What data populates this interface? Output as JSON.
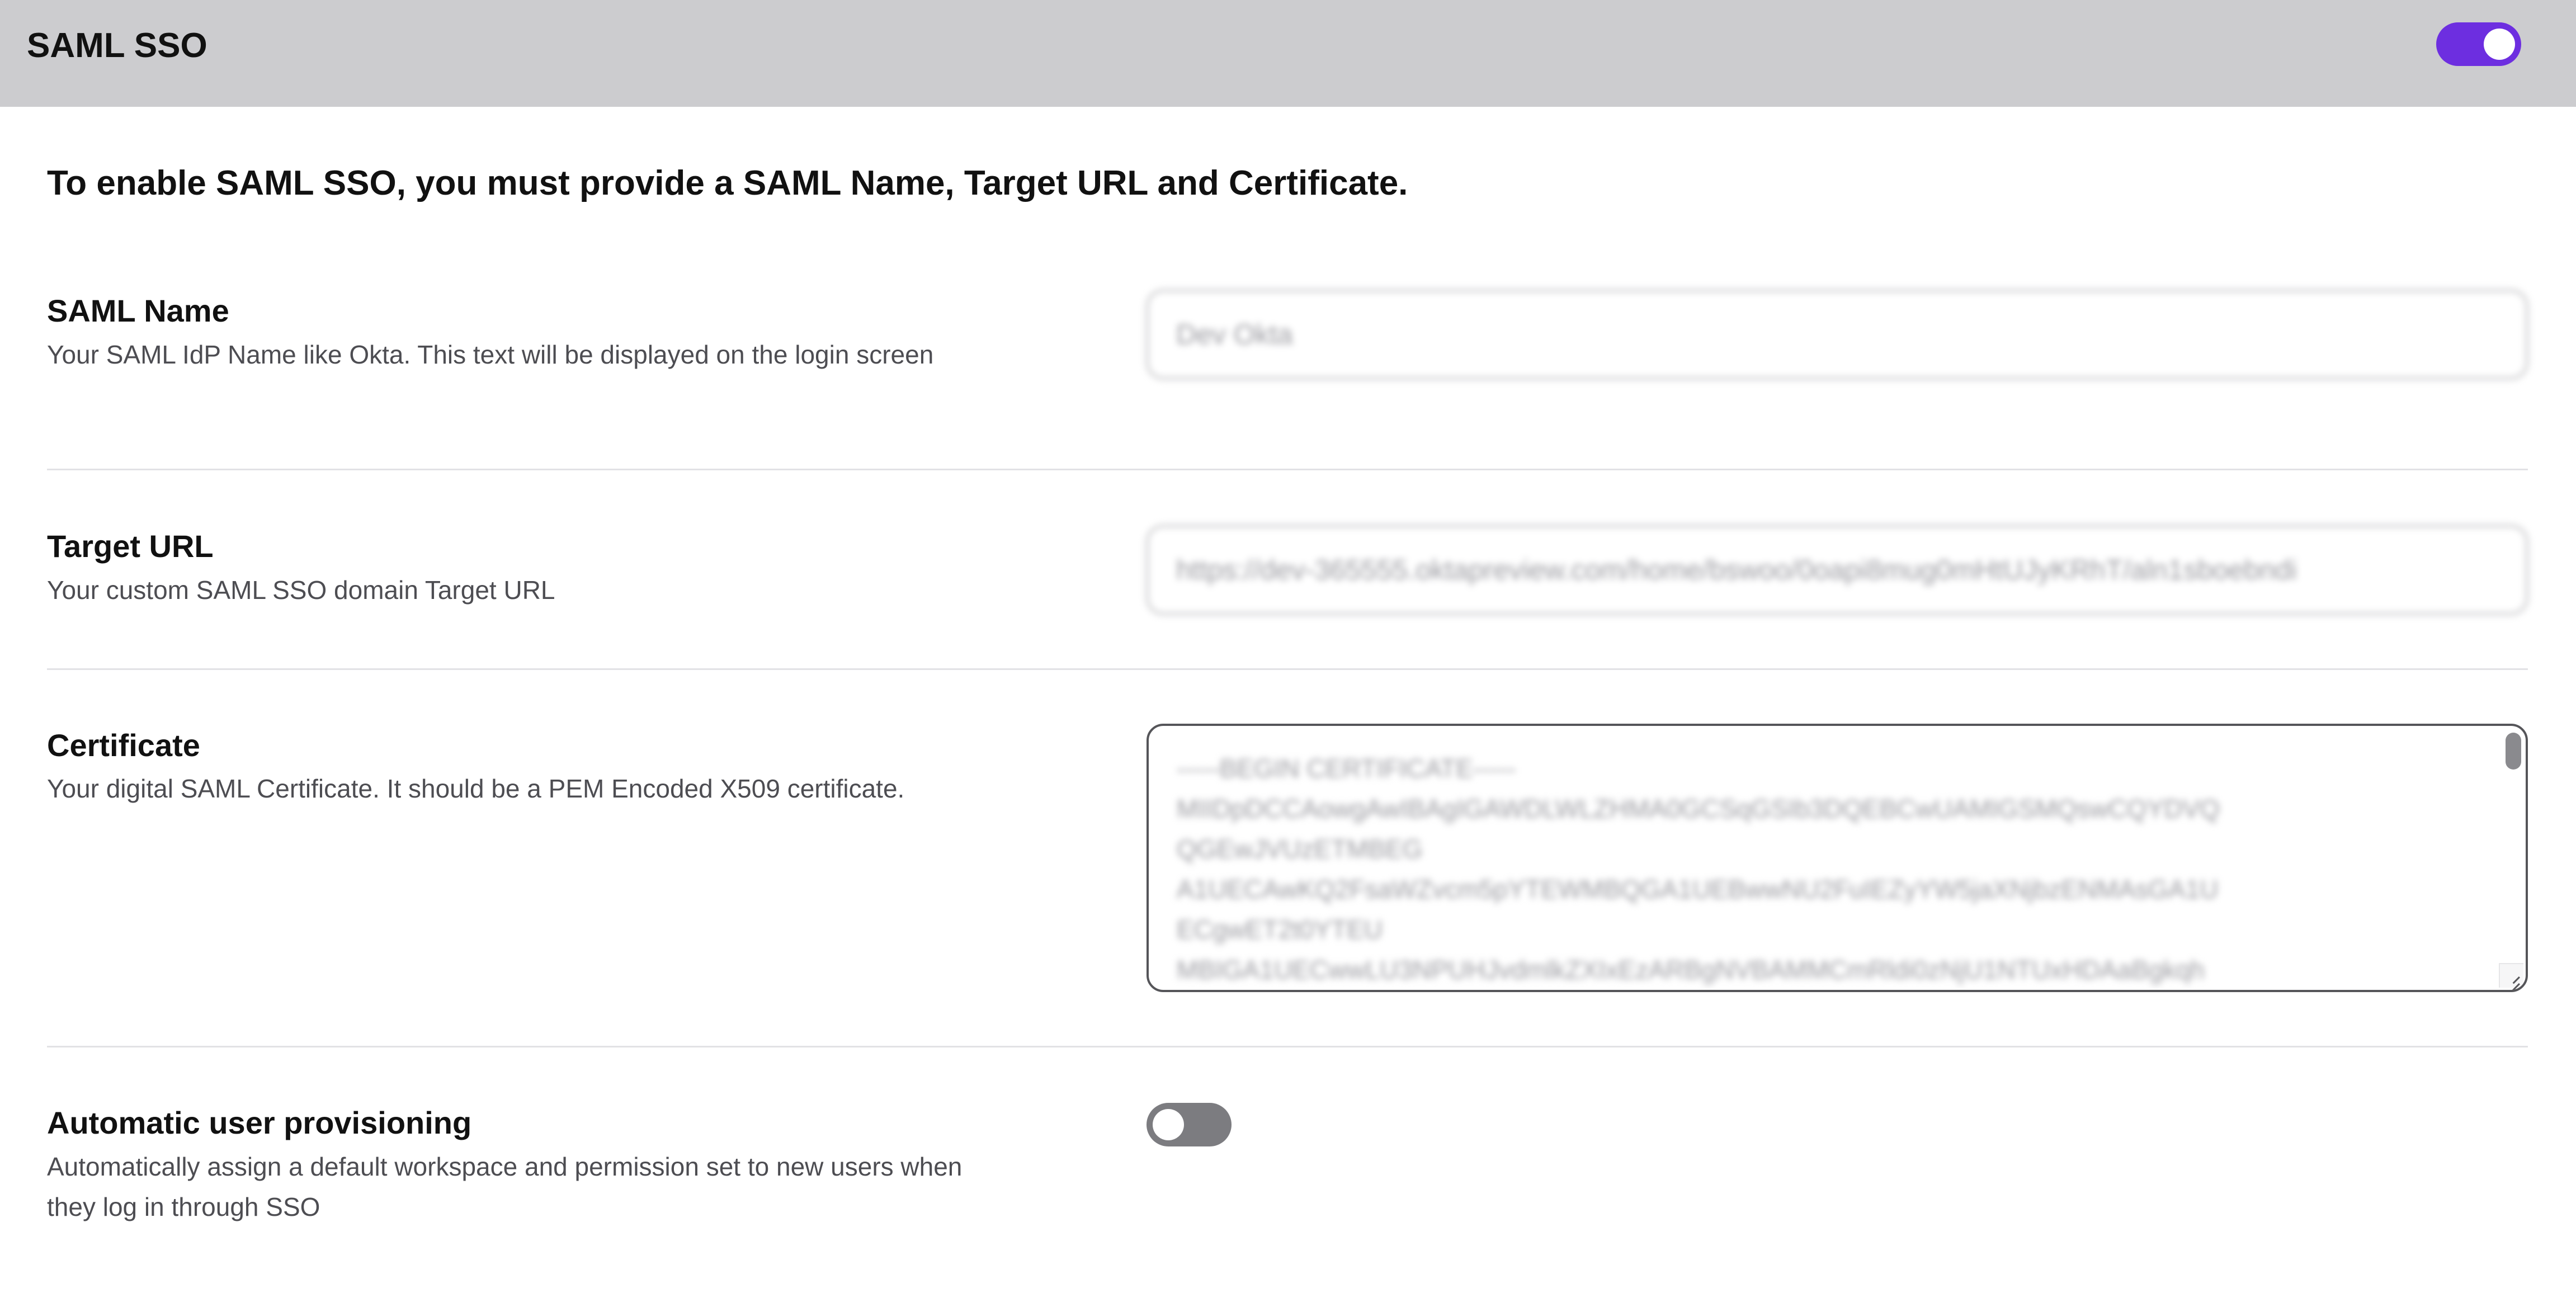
{
  "header": {
    "title": "SAML SSO",
    "sso_enabled": true
  },
  "intro_text": "To enable SAML SSO, you must provide a SAML Name, Target URL and Certificate.",
  "saml_name": {
    "label": "SAML Name",
    "description": "Your SAML IdP Name like Okta. This text will be displayed on the login screen",
    "value": "Dev Okta"
  },
  "target_url": {
    "label": "Target URL",
    "description": "Your custom SAML SSO domain Target URL",
    "value": "https://dev-365555.oktapreview.com/home/bswoo/0oapi8mug0mHtUJyKRhT/aln1sboebndi"
  },
  "certificate": {
    "label": "Certificate",
    "description": "Your digital SAML Certificate. It should be a PEM Encoded X509 certificate.",
    "value": "-----BEGIN CERTIFICATE-----\nMIIDpDCCAowgAwIBAgIGAWDLWLZHMA0GCSqGSIb3DQEBCwUAMIGSMQswCQYDVQ\nQGEwJVUzETMBEG\nA1UECAwKQ2FsaWZvcm5pYTEWMBQGA1UEBwwNU2FuIEZyYW5jaXNjbzENMAsGA1U\nECgwET2t0YTEU\nMBIGA1UECwwLU3NPUHJvdmlkZXIxEzARBgNVBAMMCmRldi0zNjU1NTUxHDAaBgkqh"
  },
  "auto_provisioning": {
    "label": "Automatic user provisioning",
    "description": "Automatically assign a default workspace and permission set to new users when they log in through SSO",
    "enabled": false
  },
  "icons": {
    "sso_toggle": "toggle-switch-icon",
    "provisioning_toggle": "toggle-switch-icon",
    "resize": "resize-grip-icon"
  },
  "colors": {
    "header_bg": "#cccccf",
    "toggle_on": "#6d2ee0",
    "toggle_off": "#7c7c80",
    "text_primary": "#111111",
    "text_secondary": "#4d4d52",
    "divider": "#e2e2e5"
  }
}
